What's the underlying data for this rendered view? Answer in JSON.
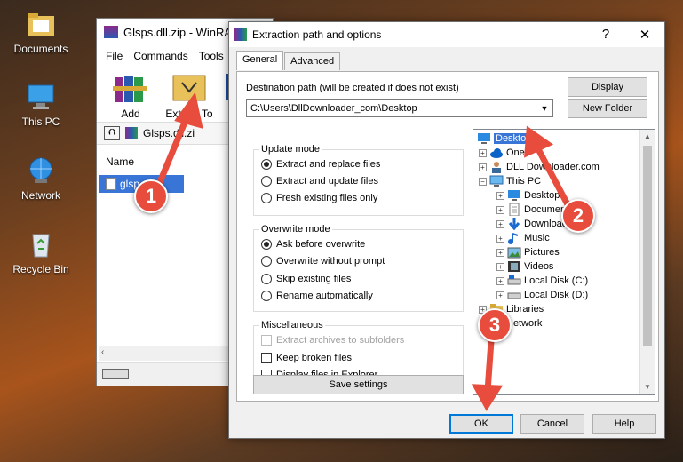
{
  "desktop": {
    "icons": [
      {
        "label": "Documents",
        "icon": "folder-documents-icon"
      },
      {
        "label": "This PC",
        "icon": "computer-icon"
      },
      {
        "label": "Network",
        "icon": "network-globe-icon"
      },
      {
        "label": "Recycle Bin",
        "icon": "recycle-bin-icon"
      }
    ]
  },
  "winrar": {
    "title": "Glsps.dll.zip - WinRA",
    "menu": [
      "File",
      "Commands",
      "Tools"
    ],
    "toolbar": {
      "add": "Add",
      "extract": "Extract To"
    },
    "path": "Glsps.dll.zi",
    "column_name": "Name",
    "file": "glsp"
  },
  "dialog": {
    "title": "Extraction path and options",
    "help": "?",
    "close": "✕",
    "tabs": [
      "General",
      "Advanced"
    ],
    "dest_label": "Destination path (will be created if does not exist)",
    "dest_value": "C:\\Users\\DllDownloader_com\\Desktop",
    "display_btn": "Display",
    "newfolder_btn": "New Folder",
    "update_mode": {
      "title": "Update mode",
      "options": [
        "Extract and replace files",
        "Extract and update files",
        "Fresh existing files only"
      ],
      "selected": 0
    },
    "overwrite_mode": {
      "title": "Overwrite mode",
      "options": [
        "Ask before overwrite",
        "Overwrite without prompt",
        "Skip existing files",
        "Rename automatically"
      ],
      "selected": 0
    },
    "misc": {
      "title": "Miscellaneous",
      "options": [
        "Extract archives to subfolders",
        "Keep broken files",
        "Display files in Explorer"
      ]
    },
    "save_btn": "Save settings",
    "tree": {
      "desktop": "Desktop",
      "onedrive": "OneD",
      "user": "DLL Downloader.com",
      "thispc": "This PC",
      "pc_children": [
        "Desktop",
        "Documents",
        "Downloads",
        "Music",
        "Pictures",
        "Videos",
        "Local Disk (C:)",
        "Local Disk (D:)"
      ],
      "libraries": "Libraries",
      "network": "Network"
    },
    "ok": "OK",
    "cancel": "Cancel",
    "help_btn": "Help"
  },
  "annotations": {
    "step1": "1",
    "step2": "2",
    "step3": "3",
    "color": "#e84c3d"
  }
}
